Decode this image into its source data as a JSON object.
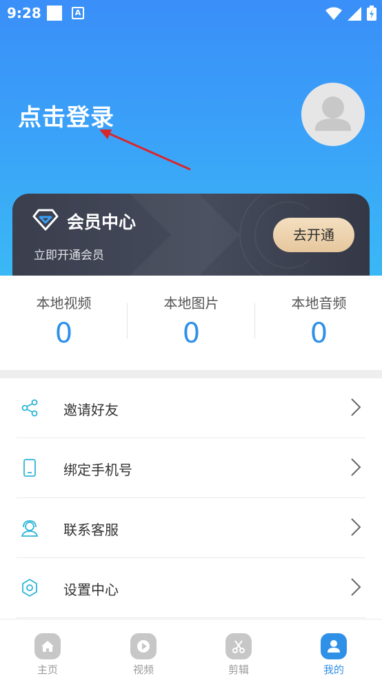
{
  "status_bar": {
    "time": "9:28"
  },
  "header": {
    "login_text": "点击登录"
  },
  "vip_card": {
    "title": "会员中心",
    "subtitle": "立即开通会员",
    "button": "去开通"
  },
  "stats": [
    {
      "label": "本地视频",
      "value": "0"
    },
    {
      "label": "本地图片",
      "value": "0"
    },
    {
      "label": "本地音频",
      "value": "0"
    }
  ],
  "menu": [
    {
      "label": "邀请好友",
      "icon": "share-icon"
    },
    {
      "label": "绑定手机号",
      "icon": "phone-icon"
    },
    {
      "label": "联系客服",
      "icon": "customer-service-icon"
    },
    {
      "label": "设置中心",
      "icon": "settings-icon"
    }
  ],
  "bottom_nav": [
    {
      "label": "主页",
      "icon": "home-icon",
      "active": false
    },
    {
      "label": "视频",
      "icon": "play-icon",
      "active": false
    },
    {
      "label": "剪辑",
      "icon": "scissors-icon",
      "active": false
    },
    {
      "label": "我的",
      "icon": "user-icon",
      "active": true
    }
  ],
  "colors": {
    "accent": "#2f90e8",
    "menu_icon": "#2bb5d8",
    "nav_inactive": "#c7c7c7",
    "nav_active": "#2f90e8"
  }
}
